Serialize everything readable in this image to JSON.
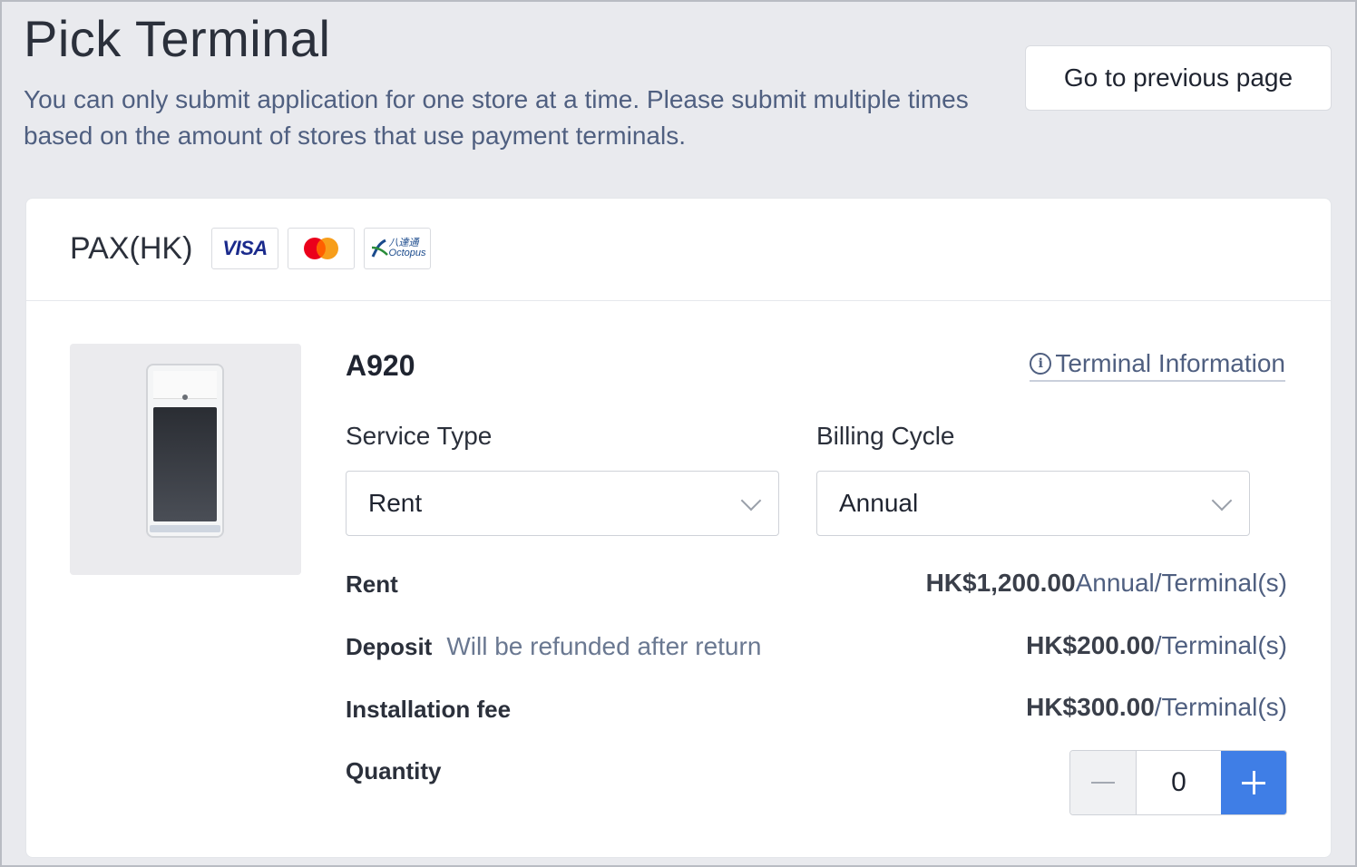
{
  "header": {
    "title": "Pick Terminal",
    "description": "You can only submit application for one store at a time. Please submit multiple times based on the amount of stores that use payment terminals.",
    "back_button": "Go to previous page"
  },
  "provider": {
    "name": "PAX(HK)",
    "logos": {
      "visa": "VISA",
      "mastercard": "mastercard-logo",
      "octopus_cn": "八達通",
      "octopus_en": "Octopus"
    }
  },
  "terminal": {
    "model": "A920",
    "info_link": "Terminal Information",
    "service_type": {
      "label": "Service Type",
      "value": "Rent"
    },
    "billing_cycle": {
      "label": "Billing Cycle",
      "value": "Annual"
    },
    "rent": {
      "label": "Rent",
      "amount": "HK$1,200.00",
      "unit": "Annual/Terminal(s)"
    },
    "deposit": {
      "label": "Deposit",
      "note": "Will be refunded after return",
      "amount": "HK$200.00",
      "unit": "/Terminal(s)"
    },
    "installation": {
      "label": "Installation fee",
      "amount": "HK$300.00",
      "unit": "/Terminal(s)"
    },
    "quantity": {
      "label": "Quantity",
      "value": "0"
    }
  },
  "colors": {
    "accent": "#3f7ee6",
    "background": "#e9eaee",
    "muted_text": "#4f5f80"
  }
}
